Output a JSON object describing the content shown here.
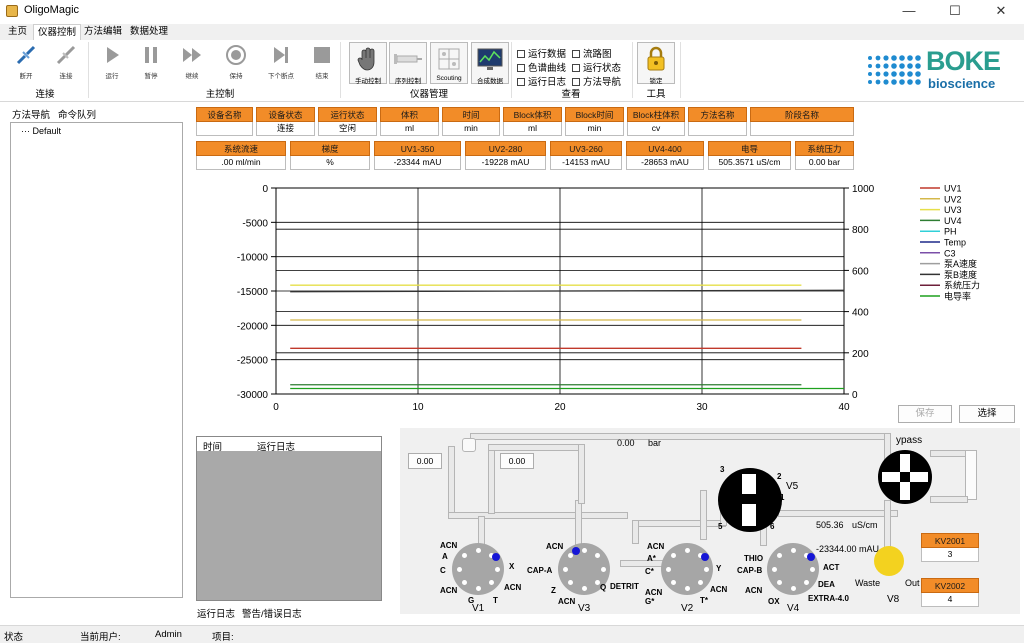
{
  "window": {
    "title": "OligoMagic",
    "minimize": "—",
    "maximize": "☐",
    "close": "✕"
  },
  "tabs": [
    "主页",
    "仪器控制",
    "方法编辑",
    "数据处理"
  ],
  "ribbon": {
    "connect": {
      "group": "连接",
      "items": [
        "断开",
        "连接"
      ]
    },
    "main_control": {
      "group": "主控制",
      "items": [
        "运行",
        "暂停",
        "继续",
        "保持",
        "下个断点",
        "结束"
      ]
    },
    "instrument": {
      "group": "仪器管理",
      "items": [
        "手动控制",
        "序列控制",
        "Scouting",
        "合成数据"
      ]
    },
    "view": {
      "group": "查看",
      "items": [
        "运行数据",
        "流路图",
        "色谱曲线",
        "运行状态",
        "运行日志",
        "方法导航"
      ]
    },
    "tools": {
      "group": "工具",
      "items": [
        "锁定"
      ]
    }
  },
  "brand": {
    "name": "BOKE",
    "sub": "bioscience",
    "color": "#2a9d8f"
  },
  "left_panel": {
    "tabs": [
      "方法导航",
      "命令队列"
    ],
    "tree_root": "Default"
  },
  "status_row1": [
    {
      "h": "设备名称",
      "v": ""
    },
    {
      "h": "设备状态",
      "v": "连接"
    },
    {
      "h": "运行状态",
      "v": "空闲"
    },
    {
      "h": "体积",
      "v": "ml"
    },
    {
      "h": "时间",
      "v": "min"
    },
    {
      "h": "Block体积",
      "v": "ml"
    },
    {
      "h": "Block时间",
      "v": "min"
    },
    {
      "h": "Block柱体积",
      "v": "cv"
    },
    {
      "h": "方法名称",
      "v": ""
    },
    {
      "h": "阶段名称",
      "v": ""
    }
  ],
  "status_row2": [
    {
      "h": "系统流速",
      "v": ".00 ml/min"
    },
    {
      "h": "梯度",
      "v": "%"
    },
    {
      "h": "UV1-350",
      "v": "-23344 mAU"
    },
    {
      "h": "UV2-280",
      "v": "-19228 mAU"
    },
    {
      "h": "UV3-260",
      "v": "-14153 mAU"
    },
    {
      "h": "UV4-400",
      "v": "-28653 mAU"
    },
    {
      "h": "电导",
      "v": "505.3571 uS/cm"
    },
    {
      "h": "系统压力",
      "v": "0.00 bar"
    }
  ],
  "chart_data": {
    "type": "line",
    "x_ticks": [
      "0",
      "10",
      "20",
      "30",
      "40"
    ],
    "xlim": [
      0,
      40
    ],
    "y_left_ticks": [
      "0",
      "-5000",
      "-10000",
      "-15000",
      "-20000",
      "-25000",
      "-30000"
    ],
    "ylim_left": [
      -30000,
      0
    ],
    "y_right_ticks": [
      "1000",
      "800",
      "600",
      "400",
      "200",
      "0"
    ],
    "ylim_right": [
      0,
      1000
    ],
    "grid": true,
    "legend_position": "right",
    "series": [
      {
        "name": "UV1",
        "color": "#c0392b",
        "x": [
          1,
          37
        ],
        "y": [
          -23344,
          -23344
        ]
      },
      {
        "name": "UV2",
        "color": "#d4b84a",
        "x": [
          1,
          37
        ],
        "y": [
          -19228,
          -19228
        ]
      },
      {
        "name": "UV3",
        "color": "#e6df4a",
        "x": [
          1,
          37
        ],
        "y": [
          -14153,
          -14153
        ]
      },
      {
        "name": "UV4",
        "color": "#2e7d32",
        "x": [
          1,
          37
        ],
        "y": [
          -28653,
          -28653
        ]
      },
      {
        "name": "PH",
        "color": "#31d0d8"
      },
      {
        "name": "Temp",
        "color": "#1f2a8a"
      },
      {
        "name": "C3",
        "color": "#7b4fa8"
      },
      {
        "name": "泵A速度",
        "color": "#9e9e9e"
      },
      {
        "name": "泵B速度",
        "color": "#333333",
        "x": [
          1,
          40
        ],
        "y": [
          -15100,
          -14900
        ]
      },
      {
        "name": "系统压力",
        "color": "#6d1f3a"
      },
      {
        "name": "电导率",
        "color": "#1ea11e",
        "x": [
          1,
          40
        ],
        "y": [
          -29200,
          -29200
        ]
      }
    ]
  },
  "chart_buttons": {
    "save": "保存",
    "select": "选择"
  },
  "log": {
    "col_time": "时间",
    "col_log": "运行日志",
    "tabs": [
      "运行日志",
      "警告/错误日志"
    ]
  },
  "flow": {
    "pressure_value": "0.00",
    "pressure_unit": "bar",
    "left_val1": "0.00",
    "left_val2": "0.00",
    "bypass": "ypass",
    "conductivity": "505.36",
    "conductivity_unit": "uS/cm",
    "uv_value": "-23344.00 mAU",
    "kv2001_label": "KV2001",
    "kv2001_value": "3",
    "kv2002_label": "KV2002",
    "kv2002_value": "4",
    "v8_name": "V8",
    "waste": "Waste",
    "out": "Out",
    "v5_name": "V5",
    "v5_ports": [
      "3",
      "2",
      "1",
      "5",
      "6"
    ],
    "valves": [
      {
        "name": "V1",
        "labels": [
          "ACN",
          "A",
          "C",
          "X",
          "ACN",
          "G",
          "T",
          "ACN"
        ]
      },
      {
        "name": "V3",
        "labels": [
          "ACN",
          "CAP-A",
          "Z",
          "ACN",
          "Q",
          "DETRIT"
        ]
      },
      {
        "name": "V2",
        "labels": [
          "ACN",
          "A*",
          "C*",
          "Y",
          "ACN",
          "G*",
          "T*",
          "ACN"
        ]
      },
      {
        "name": "V4",
        "labels": [
          "THIO",
          "CAP-B",
          "ACN",
          "OX",
          "ACT",
          "DEA",
          "EXTRA-4.0"
        ]
      }
    ]
  },
  "statusbar": {
    "status": "状态",
    "user_label": "当前用户:",
    "user": "Admin",
    "project_label": "项目:"
  }
}
